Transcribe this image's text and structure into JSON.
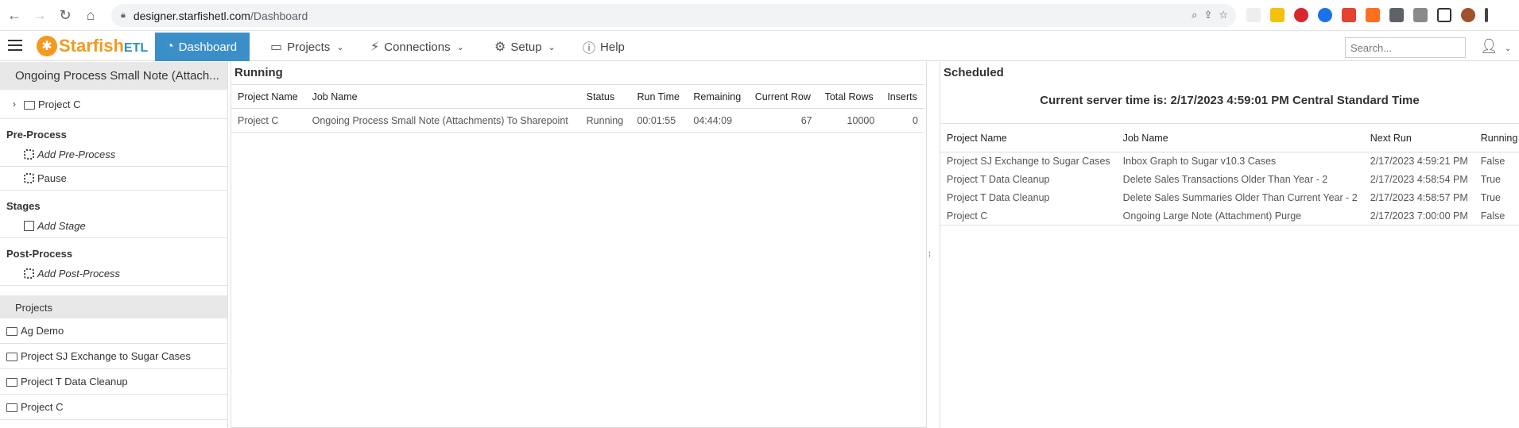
{
  "browser": {
    "url_host": "designer.starfishetl.com",
    "url_path": "/Dashboard"
  },
  "header": {
    "logo_main": "Starfish",
    "logo_suffix": "ETL",
    "nav": [
      {
        "label": "Dashboard"
      },
      {
        "label": "Projects"
      },
      {
        "label": "Connections"
      },
      {
        "label": "Setup"
      },
      {
        "label": "Help"
      }
    ],
    "search_placeholder": "Search..."
  },
  "sidebar": {
    "title": "Ongoing Process Small Note (Attach...",
    "project_tree_item": "Project C",
    "preprocess_heading": "Pre-Process",
    "add_preprocess": "Add Pre-Process",
    "pause": "Pause",
    "stages_heading": "Stages",
    "add_stage": "Add Stage",
    "postprocess_heading": "Post-Process",
    "add_postprocess": "Add Post-Process",
    "projects_heading": "Projects",
    "projects": [
      "Ag Demo",
      "Project SJ Exchange to Sugar Cases",
      "Project T Data Cleanup",
      "Project C"
    ]
  },
  "running": {
    "title": "Running",
    "columns": [
      "Project Name",
      "Job Name",
      "Status",
      "Run Time",
      "Remaining",
      "Current Row",
      "Total Rows",
      "Inserts"
    ],
    "rows": [
      [
        "Project C",
        "Ongoing Process Small Note (Attachments) To Sharepoint",
        "Running",
        "00:01:55",
        "04:44:09",
        "67",
        "10000",
        "0"
      ]
    ]
  },
  "scheduled": {
    "title": "Scheduled",
    "server_time": "Current server time is: 2/17/2023 4:59:01 PM Central Standard Time",
    "columns": [
      "Project Name",
      "Job Name",
      "Next Run",
      "Running"
    ],
    "rows": [
      [
        "Project SJ Exchange to Sugar Cases",
        "Inbox Graph to Sugar v10.3 Cases",
        "2/17/2023 4:59:21 PM",
        "False"
      ],
      [
        "Project T Data Cleanup",
        "Delete Sales Transactions Older Than Year - 2",
        "2/17/2023 4:58:54 PM",
        "True"
      ],
      [
        "Project T Data Cleanup",
        "Delete Sales Summaries Older Than Current Year - 2",
        "2/17/2023 4:58:57 PM",
        "True"
      ],
      [
        "Project C",
        "Ongoing Large Note (Attachment) Purge",
        "2/17/2023 7:00:00 PM",
        "False"
      ]
    ]
  }
}
